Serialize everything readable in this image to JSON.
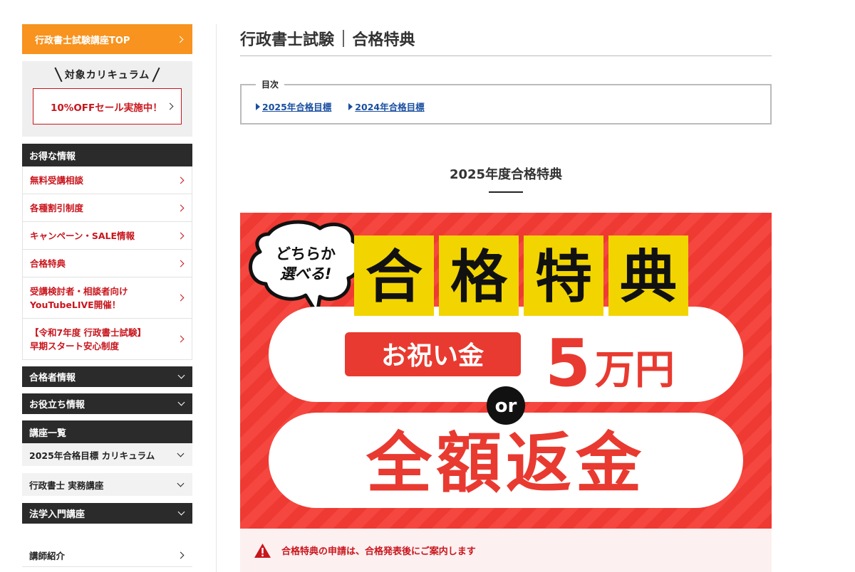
{
  "sidebar": {
    "top_button": "行政書士試験講座TOP",
    "curriculum_title": "対象カリキュラム",
    "sale_button": "10%OFFセール実施中！",
    "deals_heading": "お得な情報",
    "deals_items": [
      "無料受講相談",
      "各種割引制度",
      "キャンペーン・SALE情報",
      "合格特典",
      "受講検討者・相談者向け\nYouTubeLIVE開催！",
      "【令和7年度 行政書士試験】\n早期スタート安心制度"
    ],
    "passers_heading": "合格者情報",
    "useful_heading": "お役立ち情報",
    "courses_heading": "講座一覧",
    "course_items": [
      "2025年合格目標 カリキュラム",
      "行政書士 実務講座"
    ],
    "law_heading": "法学入門講座",
    "instructors": "講師紹介"
  },
  "main": {
    "title_left": "行政書士試験",
    "title_right": "合格特典",
    "toc_label": "目次",
    "toc_links": [
      "2025年合格目標",
      "2024年合格目標"
    ],
    "section_title": "2025年度合格特典",
    "notice": "合格特典の申請は、合格発表後にご案内します"
  },
  "banner": {
    "bubble_line1": "どちらか",
    "bubble_line2": "選べる!",
    "title_chars": [
      "合",
      "格",
      "特",
      "典"
    ],
    "gift_label": "お祝い金",
    "amount_number": "5",
    "amount_unit": "万円",
    "or_text": "or",
    "refund_text": "全額返金"
  },
  "colors": {
    "accent_orange": "#f7931e",
    "brand_red": "#c8161d",
    "dark_header": "#2b2b2b",
    "banner_red": "#f5473f",
    "banner_yellow": "#f2d500",
    "link_blue": "#1a4fa0"
  }
}
